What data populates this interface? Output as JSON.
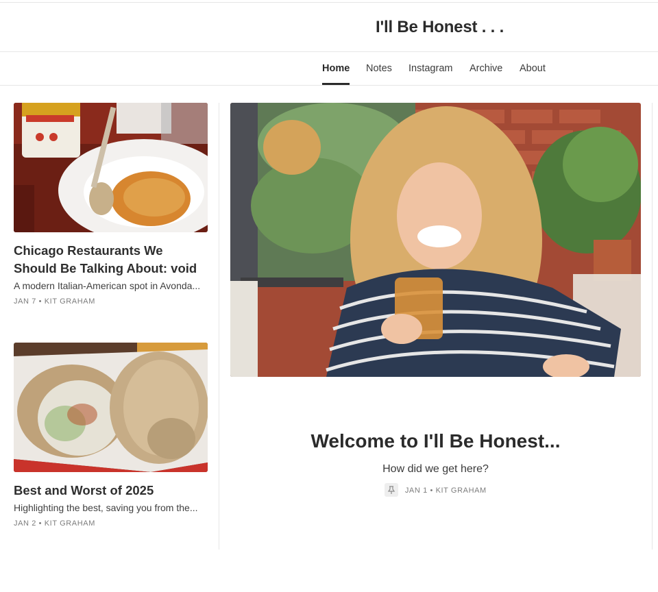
{
  "header": {
    "title": "I'll Be Honest . . ."
  },
  "nav": {
    "items": [
      {
        "label": "Home",
        "active": true
      },
      {
        "label": "Notes"
      },
      {
        "label": "Instagram"
      },
      {
        "label": "Archive"
      },
      {
        "label": "About"
      }
    ]
  },
  "posts": [
    {
      "title": "Chicago Restaurants We Should Be Talking About: void",
      "subtitle": "A modern Italian-American spot in Avonda...",
      "date": "JAN 7",
      "author": "KIT GRAHAM",
      "image": "pasta-dish-photo"
    },
    {
      "title": "Best and Worst of 2025",
      "subtitle": "Highlighting the best, saving you from the...",
      "date": "JAN 2",
      "author": "KIT GRAHAM",
      "image": "burrito-photo"
    }
  ],
  "featured": {
    "title": "Welcome to I'll Be Honest...",
    "subtitle": "How did we get here?",
    "date": "JAN 1",
    "author": "KIT GRAHAM",
    "pin_icon": "pin-icon",
    "image": "smiling-woman-with-drink-photo"
  },
  "separator": "•",
  "colors": {
    "text": "#2b2b2b",
    "meta": "#7c7c7c",
    "border": "#e6e6e6"
  }
}
